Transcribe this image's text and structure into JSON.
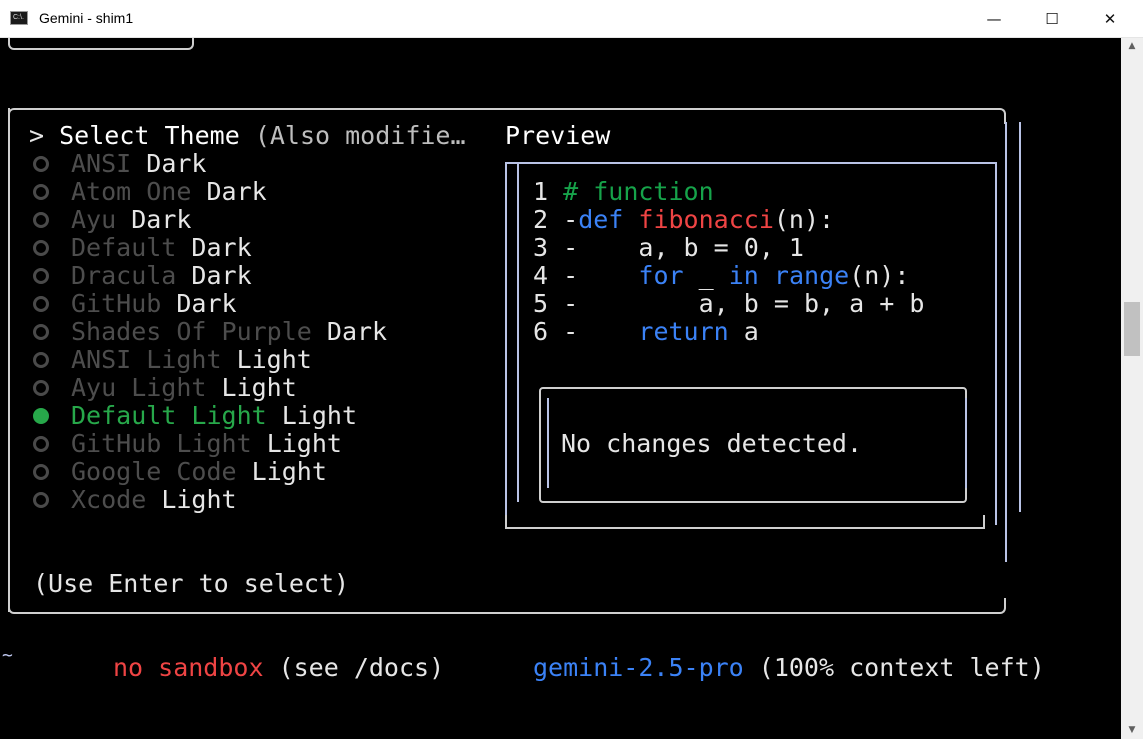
{
  "window": {
    "title": "Gemini - shim1",
    "app_icon_label": "C:\\.",
    "minimize_glyph": "—",
    "maximize_glyph": "☐",
    "close_glyph": "✕"
  },
  "theme_dialog": {
    "heading_prefix": ">",
    "heading": "Select Theme",
    "heading_suffix": "(Also modifie…",
    "preview_label": "Preview",
    "hint": "(Use Enter to select)",
    "themes": [
      {
        "name": "ANSI",
        "mode": "Dark",
        "selected": false
      },
      {
        "name": "Atom One",
        "mode": "Dark",
        "selected": false
      },
      {
        "name": "Ayu",
        "mode": "Dark",
        "selected": false
      },
      {
        "name": "Default",
        "mode": "Dark",
        "selected": false
      },
      {
        "name": "Dracula",
        "mode": "Dark",
        "selected": false
      },
      {
        "name": "GitHub",
        "mode": "Dark",
        "selected": false
      },
      {
        "name": "Shades Of Purple",
        "mode": "Dark",
        "selected": false
      },
      {
        "name": "ANSI Light",
        "mode": "Light",
        "selected": false
      },
      {
        "name": "Ayu Light",
        "mode": "Light",
        "selected": false
      },
      {
        "name": "Default Light",
        "mode": "Light",
        "selected": true
      },
      {
        "name": "GitHub Light",
        "mode": "Light",
        "selected": false
      },
      {
        "name": "Google Code",
        "mode": "Light",
        "selected": false
      },
      {
        "name": "Xcode",
        "mode": "Light",
        "selected": false
      }
    ],
    "code": {
      "line1": {
        "num": "1",
        "comment": "# function"
      },
      "line2": {
        "num": "2",
        "gutter": "-",
        "kw": "def",
        "fn": "fibonacci",
        "rest": "(n):"
      },
      "line3": {
        "num": "3",
        "gutter": "-",
        "text": "a, b = 0, 1"
      },
      "line4": {
        "num": "4",
        "gutter": "-",
        "kw": "for",
        "mid": "_",
        "kw2": "in",
        "builtin": "range",
        "rest": "(n):"
      },
      "line5": {
        "num": "5",
        "gutter": "-",
        "text": "a, b = b, a + b"
      },
      "line6": {
        "num": "6",
        "gutter": "-",
        "kw": "return",
        "rest": "a"
      }
    },
    "diff_message": "No changes detected."
  },
  "status_bar": {
    "tilde": "~",
    "sandbox": "no sandbox",
    "sandbox_hint": "(see /docs)",
    "model": "gemini-2.5-pro",
    "context": "(100% context left)"
  },
  "colors": {
    "selected_green": "#27a84a",
    "keyword_blue": "#3b82f6",
    "function_red": "#ef4444",
    "comment_green": "#16a34a",
    "border": "#b9c3e6"
  }
}
